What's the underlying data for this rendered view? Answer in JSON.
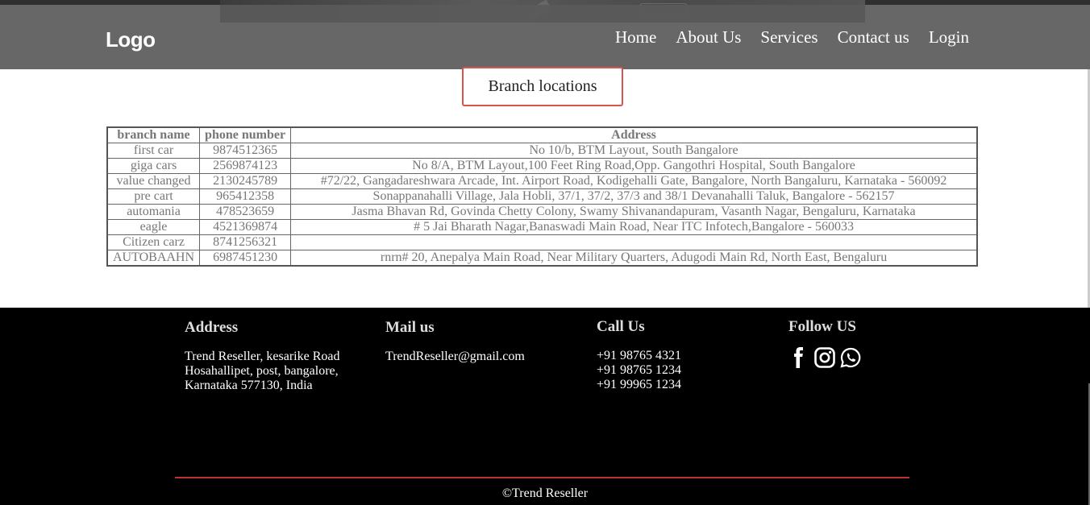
{
  "header": {
    "logo": "Logo",
    "nav": [
      "Home",
      "About Us",
      "Services",
      "Contact us",
      "Login"
    ]
  },
  "branch_button": "Branch locations",
  "table": {
    "headers": [
      "branch name",
      "phone number",
      "Address"
    ],
    "rows": [
      [
        "first car",
        "9874512365",
        "No 10/b, BTM Layout, South Bangalore"
      ],
      [
        "giga cars",
        "2569874123",
        "No 8/A, BTM Layout,100 Feet Ring Road,Opp. Gangothri Hospital, South Bangalore"
      ],
      [
        "value changed",
        "2130245789",
        "#72/22, Gangadareshwara Arcade, Int. Airport Road, Kodigehalli Gate, Bangalore, North Bangaluru, Karnataka - 560092"
      ],
      [
        "pre cart",
        "965412358",
        "Sonappanahalli Village, Jala Hobli, 37/1, 37/2, 37/3 and 38/1 Devanahalli Taluk, Bangalore - 562157"
      ],
      [
        "automania",
        "478523659",
        "Jasma Bhavan Rd, Govinda Chetty Colony, Swamy Shivanandapuram, Vasanth Nagar, Bengaluru, Karnataka"
      ],
      [
        "eagle",
        "4521369874",
        "# 5 Jai Bharath Nagar,Banaswadi Main Road, Near ITC Infotech,Bangalore - 560033"
      ],
      [
        "Citizen carz",
        "8741256321",
        ""
      ],
      [
        "AUTOBAAHN",
        "6987451230",
        "rnrn# 20, Anepalya Main Road, Near Military Quarters, Adugodi Main Rd, North East, Bengaluru"
      ]
    ]
  },
  "footer": {
    "address_title": "Address",
    "address_lines": [
      "Trend Reseller, kesarike Road",
      "Hosahallipet, post, bangalore,",
      "Karnataka 577130, India"
    ],
    "mail_title": "Mail us",
    "mail": "TrendReseller@gmail.com",
    "call_title": "Call Us",
    "phones": [
      "+91 98765 4321",
      "+91 98765 1234",
      "+91 99965 1234"
    ],
    "follow_title": "Follow US",
    "social_icons": [
      "facebook-icon",
      "instagram-icon",
      "whatsapp-icon"
    ],
    "copyright": "©Trend Reseller",
    "rule_color": "#b33333"
  }
}
